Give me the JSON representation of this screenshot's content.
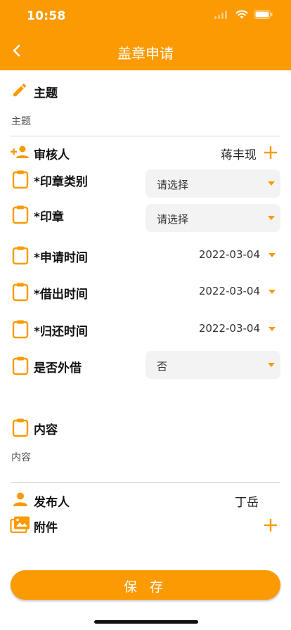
{
  "status_bar": {
    "time": "10:58"
  },
  "header": {
    "title": "盖章申请"
  },
  "form": {
    "subject": {
      "label": "主题",
      "placeholder": "主题"
    },
    "reviewer": {
      "label": "审核人",
      "value": "蒋丰现"
    },
    "seal_type": {
      "label": "*印章类别",
      "value": "请选择"
    },
    "seal": {
      "label": "*印章",
      "value": "请选择"
    },
    "apply_time": {
      "label": "*申请时间",
      "value": "2022-03-04"
    },
    "borrow_time": {
      "label": "*借出时间",
      "value": "2022-03-04"
    },
    "return_time": {
      "label": "*归还时间",
      "value": "2022-03-04"
    },
    "external": {
      "label": "是否外借",
      "value": "否"
    },
    "content": {
      "label": "内容",
      "placeholder": "内容"
    },
    "publisher": {
      "label": "发布人",
      "value": "丁岳"
    },
    "attachment": {
      "label": "附件"
    }
  },
  "save_label": "保 存",
  "colors": {
    "accent": "#fb9a02"
  },
  "icons": [
    "back-arrow-icon",
    "pencil-icon",
    "add-person-icon",
    "plus-icon",
    "clipboard-icon",
    "person-icon",
    "images-icon",
    "wifi-icon",
    "battery-icon",
    "signal-icon"
  ]
}
